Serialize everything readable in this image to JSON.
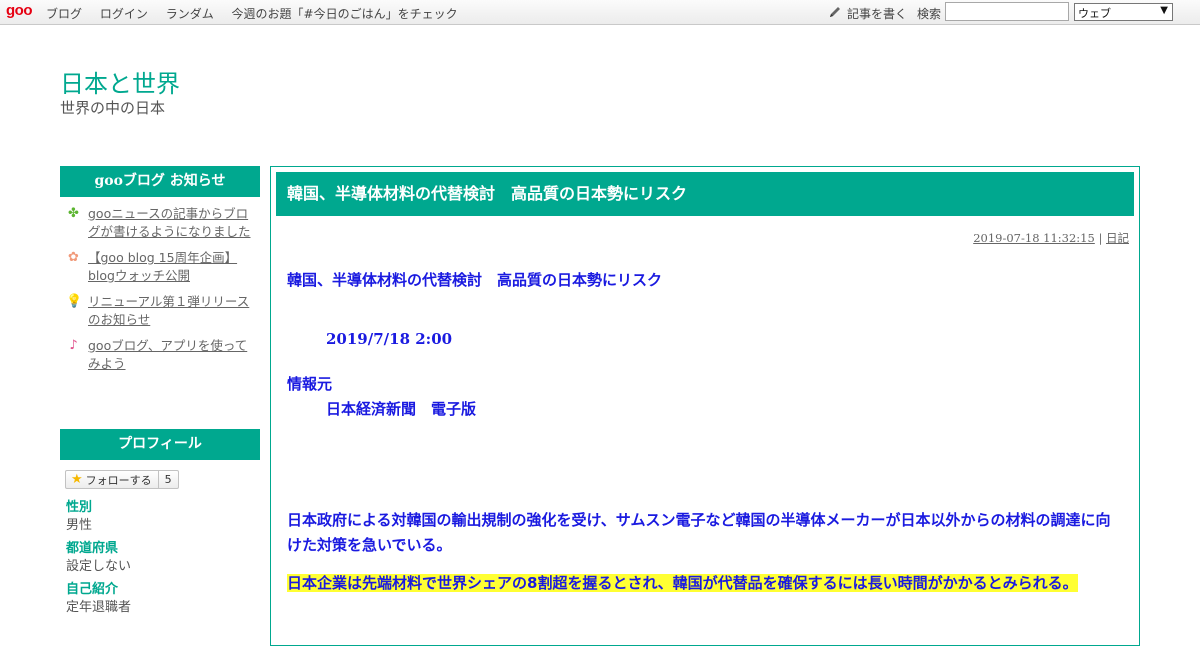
{
  "topbar": {
    "logo": "goo",
    "nav": [
      "ブログ",
      "ログイン",
      "ランダム",
      "今週のお題「#今日のごはん」をチェック"
    ],
    "write_label": "記事を書く",
    "search_label": "検索",
    "search_value": "",
    "search_scope": "ウェブ"
  },
  "header": {
    "title": "日本と世界",
    "description": "世界の中の日本"
  },
  "sidebar": {
    "notice_heading": "gooブログ お知らせ",
    "notices": [
      {
        "icon": "clover-icon",
        "text": "gooニュースの記事からブログが書けるようになりました"
      },
      {
        "icon": "flower-icon",
        "text": "【goo blog 15周年企画】blogウォッチ公開"
      },
      {
        "icon": "lightbulb-icon",
        "text": "リニューアル第１弾リリースのお知らせ"
      },
      {
        "icon": "music-note-icon",
        "text": "gooブログ、アプリを使ってみよう"
      }
    ],
    "profile_heading": "プロフィール",
    "follow_label": "フォローする",
    "follow_count": "5",
    "profile": [
      {
        "key": "性別",
        "value": "男性"
      },
      {
        "key": "都道府県",
        "value": "設定しない"
      },
      {
        "key": "自己紹介",
        "value": "定年退職者"
      }
    ]
  },
  "entry": {
    "title": "韓国、半導体材料の代替検討　高品質の日本勢にリスク",
    "timestamp": "2019-07-18 11:32:15",
    "separator": "|",
    "category": "日記",
    "body_title": "韓国、半導体材料の代替検討　高品質の日本勢にリスク",
    "date": "2019/7/18 2:00",
    "source_label": "情報元",
    "source": "日本経済新聞　電子版",
    "para1": "日本政府による対韓国の輸出規制の強化を受け、サムスン電子など韓国の半導体メーカーが日本以外からの材料の調達に向けた対策を急いでいる。",
    "para2": "日本企業は先端材料で世界シェアの8割超を握るとされ、韓国が代替品を確保するには長い時間がかかるとみられる。"
  }
}
